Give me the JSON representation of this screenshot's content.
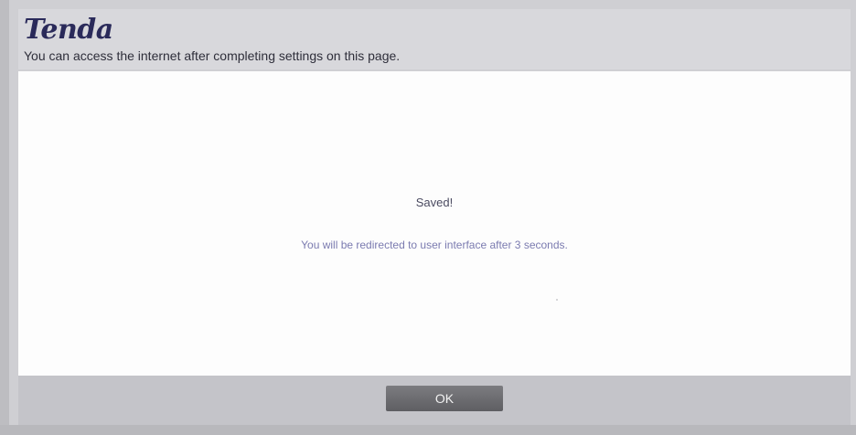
{
  "header": {
    "logo": "Tenda",
    "subtitle": "You can access the internet after completing settings on this page."
  },
  "dialog": {
    "title": "Saved!",
    "message": "You will be redirected to user interface after 3 seconds."
  },
  "footer": {
    "ok_label": "OK"
  },
  "colors": {
    "dialog_background": "#fdfdfd",
    "overlay": "#c9c9cd",
    "message_text": "#7b7bb0",
    "button": "#6a6a6e"
  }
}
